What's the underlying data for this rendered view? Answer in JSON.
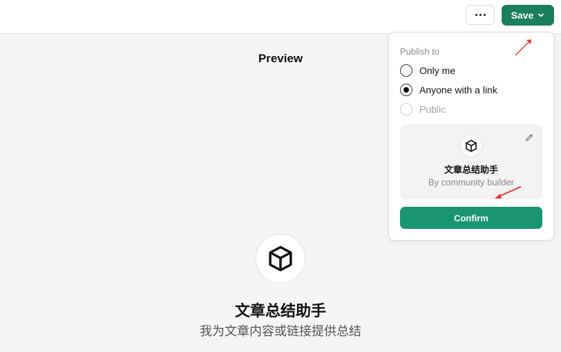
{
  "header": {
    "more_icon": "ellipsis-icon",
    "save_label": "Save",
    "save_chevron_icon": "chevron-down-icon",
    "save_color": "#1a7f5a"
  },
  "main": {
    "preview_title": "Preview",
    "gpt_icon": "cube-icon",
    "gpt_name": "文章总结助手",
    "gpt_description": "我为文章内容或链接提供总结"
  },
  "publish_panel": {
    "label": "Publish to",
    "options": [
      {
        "label": "Only me",
        "checked": false,
        "disabled": false
      },
      {
        "label": "Anyone with a link",
        "checked": true,
        "disabled": false
      },
      {
        "label": "Public",
        "checked": false,
        "disabled": true
      }
    ],
    "card": {
      "icon": "cube-icon",
      "edit_icon": "pencil-icon",
      "title": "文章总结助手",
      "subtitle": "By community builder"
    },
    "confirm_label": "Confirm",
    "confirm_color": "#1a9670"
  },
  "annotations": {
    "arrow_color": "#e8362a"
  }
}
